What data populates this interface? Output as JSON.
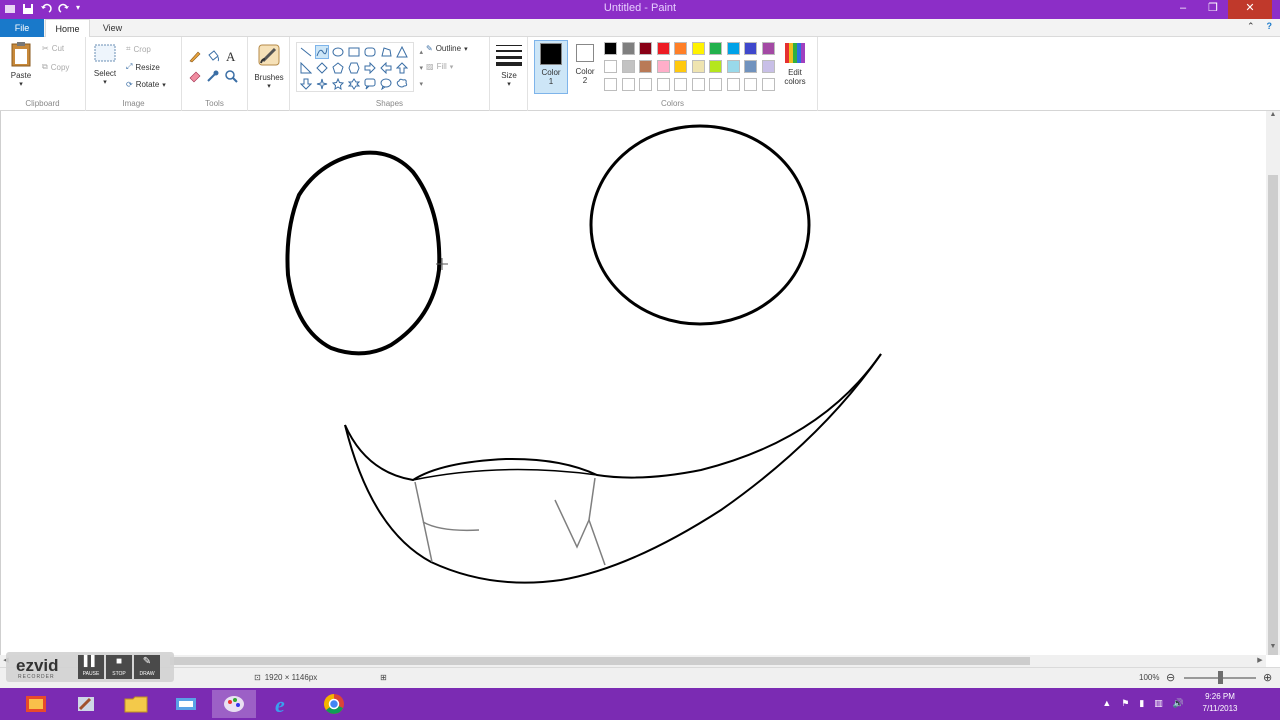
{
  "window": {
    "title": "Untitled - Paint",
    "quick_access": [
      "save-icon",
      "undo-icon",
      "redo-icon"
    ],
    "controls": [
      "minimize",
      "restore",
      "close"
    ]
  },
  "ribbon_tabs": {
    "file": "File",
    "home": "Home",
    "view": "View"
  },
  "clipboard": {
    "paste": "Paste",
    "cut": "Cut",
    "copy": "Copy",
    "label": "Clipboard"
  },
  "image": {
    "select": "Select",
    "crop": "Crop",
    "resize": "Resize",
    "rotate": "Rotate",
    "label": "Image"
  },
  "tools": {
    "label": "Tools",
    "brushes": "Brushes"
  },
  "shapes": {
    "outline": "Outline",
    "fill": "Fill",
    "label": "Shapes"
  },
  "size": {
    "label": "Size"
  },
  "colors": {
    "color1_label": "Color",
    "color1_num": "1",
    "color2_label": "Color",
    "color2_num": "2",
    "color1_value": "#000000",
    "color2_value": "#ffffff",
    "edit_label": "Edit",
    "edit_label2": "colors",
    "label": "Colors",
    "palette_row1": [
      "#000000",
      "#7f7f7f",
      "#880015",
      "#ed1c24",
      "#ff7f27",
      "#fff200",
      "#22b14c",
      "#00a2e8",
      "#3f48cc",
      "#a349a4"
    ],
    "palette_row2": [
      "#ffffff",
      "#c3c3c3",
      "#b97a57",
      "#ffaec9",
      "#ffc90e",
      "#efe4b0",
      "#b5e61d",
      "#99d9ea",
      "#7092be",
      "#c8bfe7"
    ],
    "palette_row3": [
      "#ffffff",
      "#ffffff",
      "#ffffff",
      "#ffffff",
      "#ffffff",
      "#ffffff",
      "#ffffff",
      "#ffffff",
      "#ffffff",
      "#ffffff"
    ]
  },
  "status": {
    "dimensions": "1920 × 1146px",
    "zoom": "100%"
  },
  "ezvid": {
    "logo": "ezvid",
    "sub": "RECORDER",
    "buttons": [
      "PAUSE",
      "STOP",
      "DRAW"
    ]
  },
  "taskbar": {
    "apps": [
      "recorder-app-icon",
      "paint-brush-app-icon",
      "file-explorer-icon",
      "paint-app-icon",
      "internet-explorer-icon",
      "chrome-icon"
    ],
    "time": "9:26 PM",
    "date": "7/11/2013"
  }
}
